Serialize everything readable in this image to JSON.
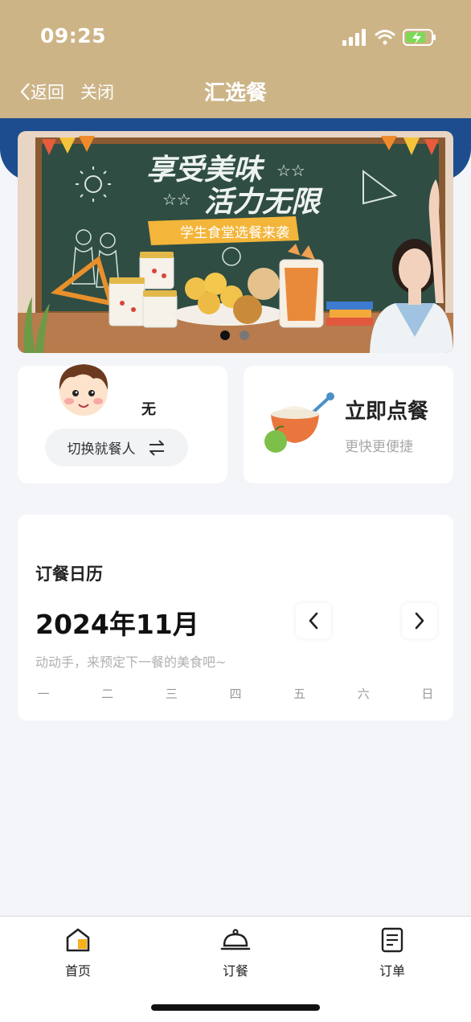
{
  "status_bar": {
    "time": "09:25"
  },
  "nav": {
    "back_label": "返回",
    "close_label": "关闭",
    "title": "汇选餐"
  },
  "banner": {
    "headline_1": "享受美味",
    "headline_2": "活力无限",
    "ribbon": "学生食堂选餐来袭",
    "active_slide": 1,
    "slide_count": 2
  },
  "diner": {
    "name": "无",
    "switch_label": "切换就餐人"
  },
  "quick_order": {
    "title": "立即点餐",
    "subtitle": "更快更便捷"
  },
  "calendar": {
    "label": "订餐日历",
    "month": "2024年11月",
    "hint": "动动手，来预定下一餐的美食吧~",
    "weekdays": [
      "一",
      "二",
      "三",
      "四",
      "五",
      "六",
      "日"
    ]
  },
  "tabs": [
    {
      "label": "首页",
      "icon": "home-icon",
      "active": true
    },
    {
      "label": "订餐",
      "icon": "cloche-icon",
      "active": false
    },
    {
      "label": "订单",
      "icon": "order-list-icon",
      "active": false
    }
  ],
  "colors": {
    "header_bg": "#cdb487",
    "band_blue": "#1d4d8e",
    "page_bg": "#f4f5f8",
    "accent_yellow": "#f5b21b"
  }
}
